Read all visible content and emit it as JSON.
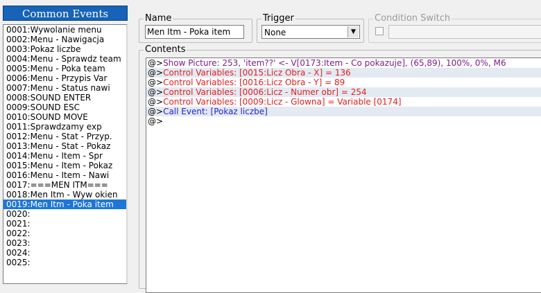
{
  "list_title": "Common Events",
  "events": [
    "0001:Wywolanie menu",
    "0002:Menu - Nawigacja",
    "0003:Pokaz liczbe",
    "0004:Menu - Sprawdz team",
    "0005:Menu - Poka team",
    "0006:Menu - Przypis Var",
    "0007:Menu - Status nawi",
    "0008:SOUND ENTER",
    "0009:SOUND ESC",
    "0010:SOUND MOVE",
    "0011:Sprawdzamy exp",
    "0012:Menu - Stat - Przyp.",
    "0013:Menu - Stat - Pokaz",
    "0014:Menu - Item - Spr",
    "0015:Menu - Item - Pokaz",
    "0016:Menu - Item - Nawi",
    "0017:===MEN ITM===",
    "0018:Men Itm - Wyw okien",
    "0019:Men Itm - Poka item",
    "0020:",
    "0021:",
    "0022:",
    "0023:",
    "0024:",
    "0025:"
  ],
  "selected_index": 18,
  "name": {
    "label": "Name",
    "value": "Men Itm - Poka item"
  },
  "trigger": {
    "label": "Trigger",
    "value": "None"
  },
  "condition": {
    "label": "Condition Switch"
  },
  "contents": {
    "label": "Contents",
    "marker": "@>",
    "commands": [
      {
        "text": "Show Picture: 253, 'item??' <- V[0173:Item - Co pokazuje], (65,89), 100%, 0%, M6",
        "kind": "show"
      },
      {
        "text": "Control Variables: [0015:Licz Obra - X] = 136",
        "kind": "var"
      },
      {
        "text": "Control Variables: [0016:Licz Obra - Y] = 89",
        "kind": "var"
      },
      {
        "text": "Control Variables: [0006:Licz - Numer obr] = 254",
        "kind": "var"
      },
      {
        "text": "Control Variables: [0009:Licz - Glowna] = Variable [0174]",
        "kind": "var"
      },
      {
        "text": "Call Event: [Pokaz liczbe]",
        "kind": "call"
      },
      {
        "text": "",
        "kind": "end"
      }
    ]
  },
  "colors": {
    "title_bar": "#1663b7",
    "selected_row": "#1e76d6",
    "show_picture": "#7c1c8c",
    "control_variables": "#e02020",
    "call_event": "#1d24e0"
  }
}
